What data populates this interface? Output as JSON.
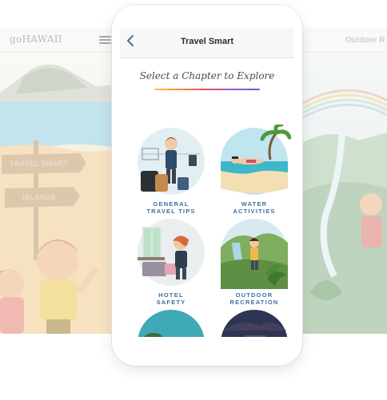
{
  "left_screen": {
    "logo": "goHAWAII",
    "signs": [
      "TRAVEL SMART",
      "ISLANDS"
    ]
  },
  "right_screen": {
    "title": "Outdoor R"
  },
  "app": {
    "title": "Travel Smart",
    "back_icon": "chevron-left-icon",
    "subtitle": "Select a Chapter to Explore",
    "accent": "#3f6f9c",
    "chapters": [
      {
        "label": "GENERAL\nTRAVEL TIPS",
        "icon": "traveler-illustration"
      },
      {
        "label": "WATER\nACTIVITIES",
        "icon": "snorkel-illustration"
      },
      {
        "label": "HOTEL\nSAFETY",
        "icon": "hotel-room-illustration"
      },
      {
        "label": "OUTDOOR\nRECREATION",
        "icon": "hiker-illustration"
      },
      {
        "label": "",
        "icon": "ocean-reef-illustration"
      },
      {
        "label": "",
        "icon": "night-city-illustration"
      }
    ]
  }
}
